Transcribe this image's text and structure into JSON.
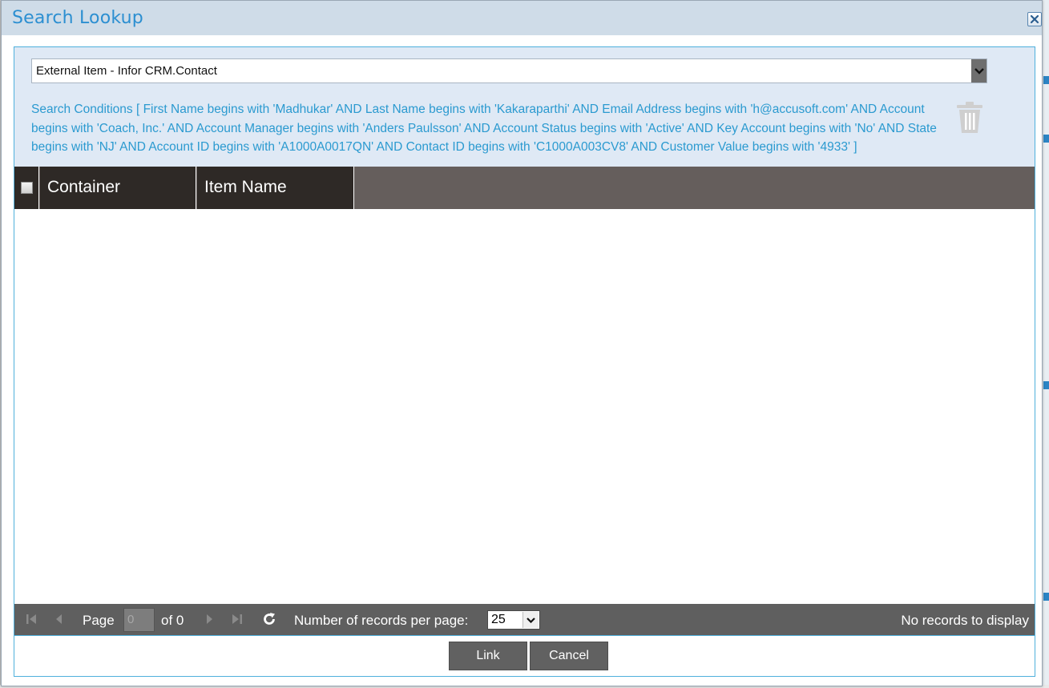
{
  "dialog": {
    "title": "Search Lookup",
    "close_icon": "close-icon"
  },
  "filter": {
    "source_select_value": "External Item - Infor CRM.Contact",
    "conditions_text": "Search Conditions [ First Name begins with 'Madhukar' AND Last Name begins with 'Kakaraparthi' AND Email Address begins with 'h@accusoft.com' AND Account begins with 'Coach, Inc.' AND Account Manager begins with 'Anders Paulsson' AND Account Status begins with 'Active' AND Key Account begins with 'No' AND State begins with 'NJ' AND Account ID begins with 'A1000A0017QN' AND Contact ID begins with 'C1000A003CV8' AND Customer Value begins with '4933' ]",
    "clear_icon": "trash-icon"
  },
  "grid": {
    "columns": [
      "Container",
      "Item Name"
    ],
    "rows": []
  },
  "pager": {
    "page_label": "Page",
    "page_value": "0",
    "of_label": "of 0",
    "per_page_label": "Number of records per page:",
    "per_page_value": "25",
    "status": "No records to display"
  },
  "footer": {
    "link_label": "Link",
    "cancel_label": "Cancel"
  },
  "colors": {
    "title": "#2c8fd1",
    "conditions": "#2b9ad0",
    "header_bg": "#2e2926",
    "pager_bg": "#5f5f5f"
  }
}
